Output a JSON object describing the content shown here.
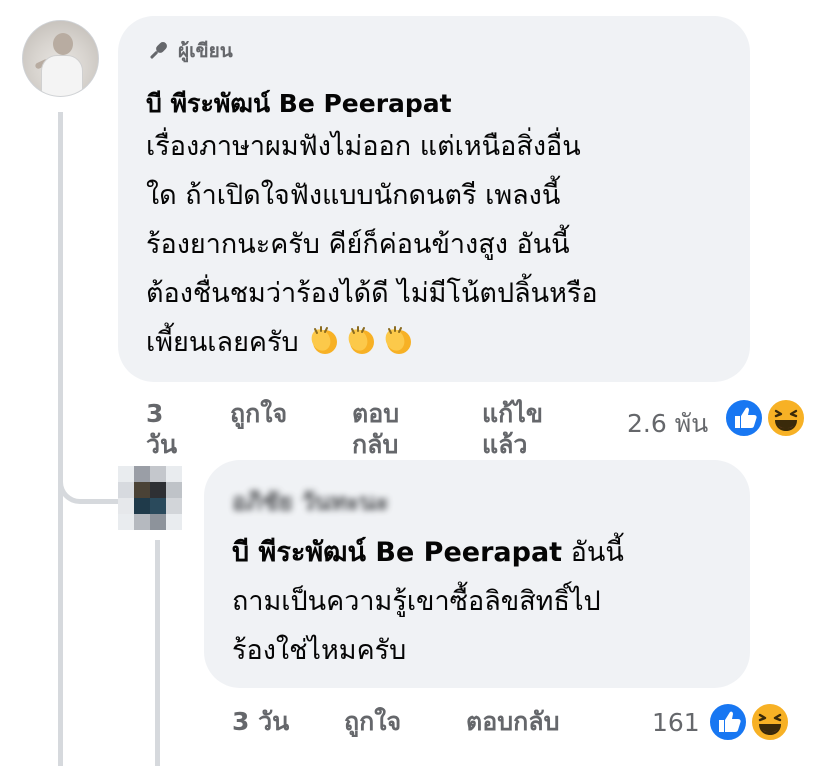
{
  "main_comment": {
    "badge_label": "ผู้เขียน",
    "author": "บี พีระพัฒน์ Be Peerapat",
    "lines": [
      "เรื่องภาษาผมฟังไม่ออก แต่เหนือสิ่งอื่น",
      "ใด ถ้าเปิดใจฟังแบบนักดนตรี เพลงนี้",
      "ร้องยากนะครับ คีย์ก็ค่อนข้างสูง อันนี้",
      "ต้องชื่นชมว่าร้องได้ดี ไม่มีโน้ตปลิ้นหรือ",
      "เพี้ยนเลยครับ"
    ],
    "emoji_icons": [
      "clapping-hands-icon",
      "clapping-hands-icon",
      "clapping-hands-icon"
    ],
    "time": "3 วัน",
    "like_label": "ถูกใจ",
    "reply_label": "ตอบกลับ",
    "edited_label": "แก้ไขแล้ว",
    "reaction_count": "2.6 พัน",
    "reactions": [
      "like-icon",
      "haha-icon"
    ]
  },
  "reply_comment": {
    "author_obscured": "อภิชัย วันทะนะ",
    "mention": "บี พีระพัฒน์ Be Peerapat",
    "line1_rest": " อันนี้",
    "lines": [
      "ถามเป็นความรู้เขาซื้อลิขสิทธิ์ไป",
      "ร้องใช่ไหมครับ"
    ],
    "time": "3 วัน",
    "like_label": "ถูกใจ",
    "reply_label": "ตอบกลับ",
    "reaction_count": "161",
    "reactions": [
      "like-icon",
      "haha-icon"
    ]
  },
  "colors": {
    "bubble": "#f0f2f5",
    "meta_text": "#65676b",
    "like_blue": "#1877f2",
    "haha_yellow": "#f7b125"
  }
}
